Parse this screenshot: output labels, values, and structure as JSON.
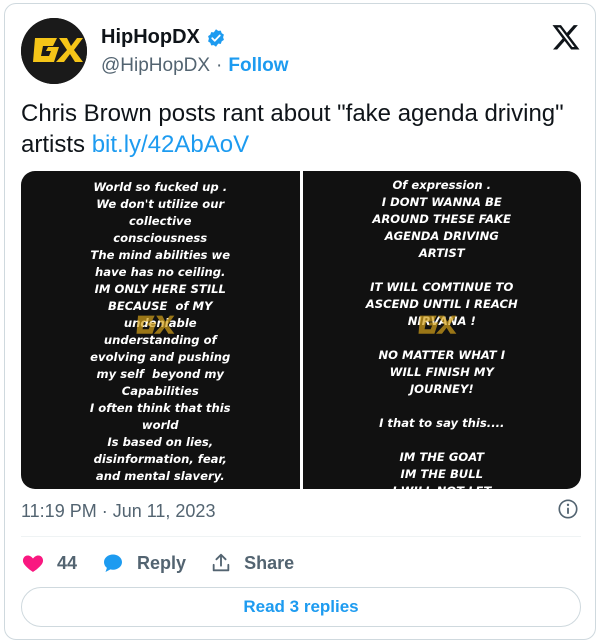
{
  "account": {
    "display_name": "HipHopDX",
    "handle": "@HipHopDX",
    "separator": "·",
    "follow_label": "Follow"
  },
  "tweet": {
    "text": "Chris Brown posts rant about \"fake agenda driving\" artists ",
    "link": "bit.ly/42AbAoV"
  },
  "media": {
    "left_lines": [
      "World so fucked up .",
      "We don't utilize our",
      "collective",
      "consciousness",
      "The mind abilities we",
      "have has no ceiling.",
      "IM ONLY HERE STILL",
      "BECAUSE  of MY",
      "undeniable",
      "understanding of",
      "evolving and pushing",
      "my self  beyond my",
      "Capabilities",
      "I often think that this",
      "world",
      "Is based on lies,",
      "disinformation, fear,",
      "and mental slavery."
    ],
    "right_lines": [
      "Of expression .",
      "I DONT WANNA BE",
      "AROUND THESE FAKE",
      "AGENDA DRIVING",
      "ARTIST",
      "",
      "IT WILL COMTINUE TO",
      "ASCEND UNTIL I REACH",
      "NIRVANA !",
      "",
      "NO MATTER WHAT I",
      "WILL FINISH MY",
      "JOURNEY!",
      "",
      "I that to say this....",
      "",
      "IM THE GOAT",
      "IM THE BULL",
      "I WILL NOT LET"
    ]
  },
  "meta": {
    "timestamp": "11:19 PM · Jun 11, 2023"
  },
  "actions": {
    "like_count": "44",
    "reply_label": "Reply",
    "share_label": "Share"
  },
  "read_replies_label": "Read 3 replies",
  "colors": {
    "accent": "#1d9bf0",
    "like": "#f91880",
    "logo_gold": "#f5c518"
  }
}
